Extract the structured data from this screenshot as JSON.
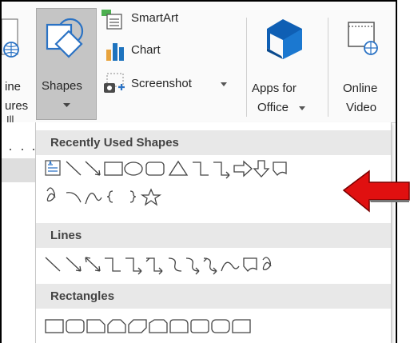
{
  "ribbon": {
    "pictures_partial_line1": "ine",
    "pictures_partial_line2": "ures",
    "illustrations_partial": "Ill",
    "shapes_label": "Shapes",
    "smartart_label": "SmartArt",
    "chart_label": "Chart",
    "screenshot_label": "Screenshot",
    "apps_line1": "Apps for",
    "apps_line2": "Office",
    "online_video_line1": "Online",
    "online_video_line2": "Video"
  },
  "gallery": {
    "sections": [
      {
        "title": "Recently Used Shapes"
      },
      {
        "title": "Lines"
      },
      {
        "title": "Rectangles"
      }
    ]
  },
  "colors": {
    "accent_blue": "#1e73be",
    "chart_orange": "#e8a33d",
    "red_arrow": "#e01010",
    "ribbon_bg": "#fafafa",
    "section_header_bg": "#e8e8e8"
  }
}
